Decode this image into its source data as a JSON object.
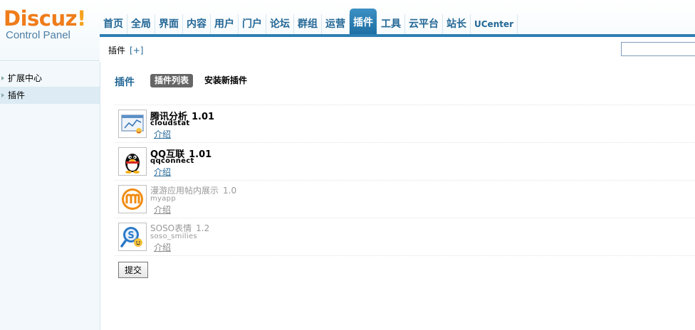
{
  "logo": {
    "brand": "Discuz",
    "bang": "!",
    "subtitle": "Control Panel"
  },
  "nav": {
    "tabs": [
      {
        "label": "首页"
      },
      {
        "label": "全局"
      },
      {
        "label": "界面"
      },
      {
        "label": "内容"
      },
      {
        "label": "用户"
      },
      {
        "label": "门户"
      },
      {
        "label": "论坛"
      },
      {
        "label": "群组"
      },
      {
        "label": "运营"
      },
      {
        "label": "插件"
      },
      {
        "label": "工具"
      },
      {
        "label": "云平台"
      },
      {
        "label": "站长"
      },
      {
        "label": "UCenter"
      }
    ],
    "active": "插件"
  },
  "subbar": {
    "crumb": "插件",
    "plus": "[+]",
    "search_value": ""
  },
  "sidebar": {
    "items": [
      {
        "label": "扩展中心"
      },
      {
        "label": "插件"
      }
    ]
  },
  "main": {
    "title": "插件",
    "tab_list": "插件列表",
    "tab_install": "安装新插件",
    "plugins": [
      {
        "name": "腾讯分析",
        "version": "1.01",
        "ident": "cloudstat",
        "intro": "介绍",
        "icon": "chart-icon"
      },
      {
        "name": "QQ互联",
        "version": "1.01",
        "ident": "qqconnect",
        "intro": "介绍",
        "icon": "qq-penguin-icon"
      },
      {
        "name": "漫游应用帖内展示",
        "version": "1.0",
        "ident": "myapp",
        "intro": "介绍",
        "icon": "manyou-m-icon"
      },
      {
        "name": "SOSO表情",
        "version": "1.2",
        "ident": "soso_smilies",
        "intro": "介绍",
        "icon": "soso-search-icon"
      }
    ],
    "submit": "提交"
  },
  "colors": {
    "accent": "#236796",
    "active_tab": "#2d7fb3",
    "logo_orange": "#ef7c1a"
  }
}
